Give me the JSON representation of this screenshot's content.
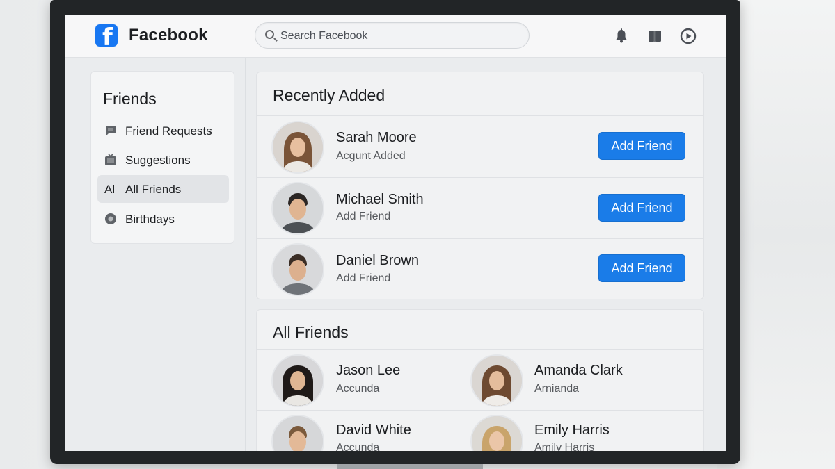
{
  "header": {
    "brand": "Facebook",
    "search_placeholder": "Search Facebook",
    "icons": [
      "bell-icon",
      "book-icon",
      "play-icon"
    ]
  },
  "sidebar": {
    "title": "Friends",
    "items": [
      {
        "label": "Friend Requests",
        "icon": "chat-bubble-icon",
        "active": false
      },
      {
        "label": "Suggestions",
        "icon": "tv-icon",
        "active": false
      },
      {
        "label": "All Friends",
        "icon_text": "Al",
        "active": true
      },
      {
        "label": "Birthdays",
        "icon": "circle-icon",
        "active": false
      }
    ]
  },
  "recently_added": {
    "title": "Recently Added",
    "button_label": "Add Friend",
    "people": [
      {
        "name": "Sarah Moore",
        "subtitle": "Acgunt Added"
      },
      {
        "name": "Michael Smith",
        "subtitle": "Add Friend"
      },
      {
        "name": "Daniel Brown",
        "subtitle": "Add Friend"
      }
    ]
  },
  "all_friends": {
    "title": "All Friends",
    "people": [
      {
        "name": "Jason Lee",
        "subtitle": "Accunda"
      },
      {
        "name": "Amanda Clark",
        "subtitle": "Arnianda"
      },
      {
        "name": "David White",
        "subtitle": "Accunda"
      },
      {
        "name": "Emily Harris",
        "subtitle": "Amily Harris"
      }
    ]
  },
  "colors": {
    "accent": "#1877f2",
    "button": "#1a7ce8",
    "screen_bg": "#eaecee",
    "card_bg": "#f1f2f3"
  }
}
